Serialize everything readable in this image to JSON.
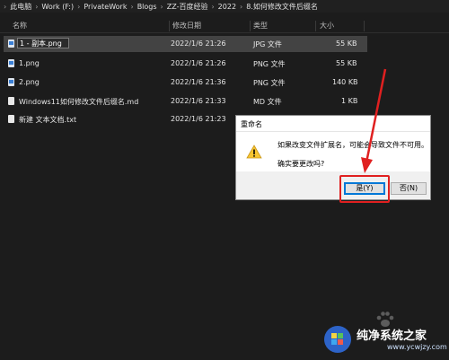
{
  "breadcrumb": {
    "items": [
      "此电脑",
      "Work (F:)",
      "PrivateWork",
      "Blogs",
      "ZZ-百度经验",
      "2022",
      "8.如何修改文件后缀名"
    ],
    "separator": "›"
  },
  "columns": {
    "name": "名称",
    "date": "修改日期",
    "type": "类型",
    "size": "大小"
  },
  "files": [
    {
      "name": "1 - 副本.png",
      "date": "2022/1/6 21:26",
      "type": "JPG 文件",
      "size": "55 KB",
      "icon": "image-file-icon",
      "editing": true
    },
    {
      "name": "1.png",
      "date": "2022/1/6 21:26",
      "type": "PNG 文件",
      "size": "55 KB",
      "icon": "image-file-icon"
    },
    {
      "name": "2.png",
      "date": "2022/1/6 21:36",
      "type": "PNG 文件",
      "size": "140 KB",
      "icon": "image-file-icon"
    },
    {
      "name": "Windows11如何修改文件后缀名.md",
      "date": "2022/1/6 21:33",
      "type": "MD 文件",
      "size": "1 KB",
      "icon": "document-file-icon"
    },
    {
      "name": "新建 文本文档.txt",
      "date": "2022/1/6 21:23",
      "type": "",
      "size": "",
      "icon": "document-file-icon"
    }
  ],
  "dialog": {
    "title": "重命名",
    "message": "如果改变文件扩展名，可能会导致文件不可用。",
    "question": "确实要更改吗?",
    "yes_label": "是(Y)",
    "no_label": "否(N)",
    "icon": "warning-icon"
  },
  "watermark": {
    "title": "纯净系统之家",
    "url": "www.ycwjzy.com"
  },
  "colors": {
    "background": "#1c1c1c",
    "annotation": "#e02020",
    "selected_row": "#434343"
  }
}
